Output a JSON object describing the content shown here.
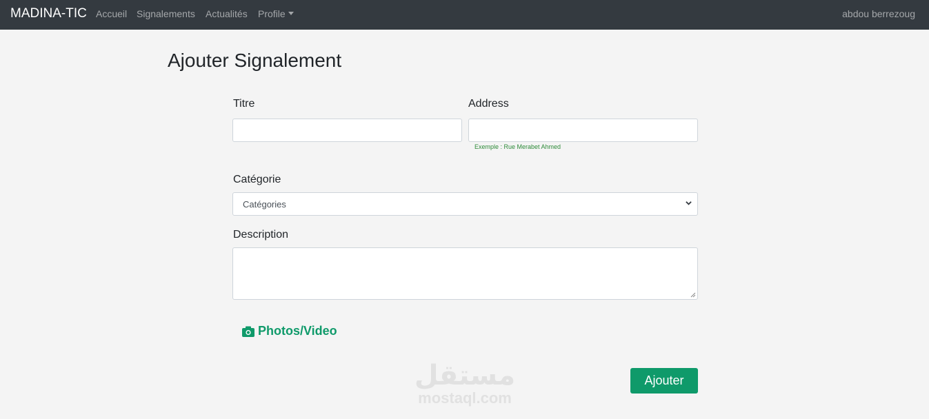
{
  "navbar": {
    "brand": "MADINA-TIC",
    "links": [
      "Accueil",
      "Signalements",
      "Actualités",
      "Profile"
    ],
    "user": "abdou berrezoug"
  },
  "page": {
    "title": "Ajouter Signalement"
  },
  "form": {
    "titre_label": "Titre",
    "titre_value": "",
    "address_label": "Address",
    "address_value": "",
    "address_help": "Exemple : Rue Merabet Ahmed",
    "categorie_label": "Catégorie",
    "categorie_selected": "Catégories",
    "description_label": "Description",
    "description_value": "",
    "media_label": "Photos/Video",
    "submit_label": "Ajouter"
  },
  "watermark": {
    "arabic": "مستقل",
    "latin": "mostaql.com"
  },
  "colors": {
    "navbar": "#343a40",
    "accent": "#0f9a6a",
    "background": "#f4f4f4"
  },
  "icons": {
    "media": "camera-icon",
    "select": "chevron-down-icon",
    "dropdown": "caret-down-icon"
  }
}
